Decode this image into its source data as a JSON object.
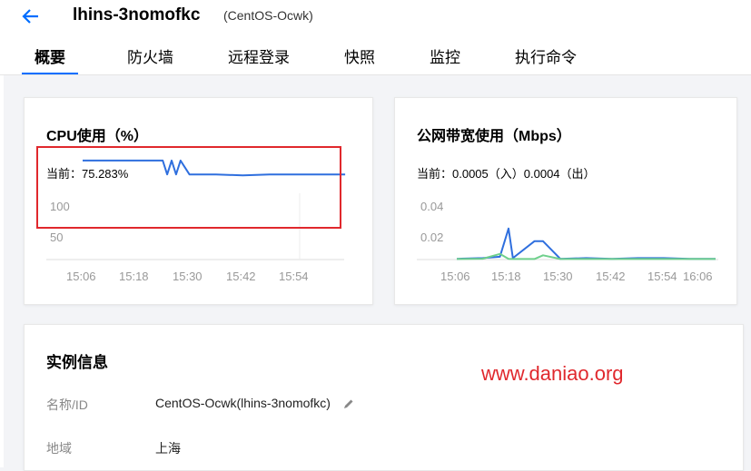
{
  "header": {
    "instance_name": "lhins-3nomofkc",
    "instance_os": "(CentOS-Ocwk)"
  },
  "tabs": [
    {
      "label": "概要",
      "active": true
    },
    {
      "label": "防火墙"
    },
    {
      "label": "远程登录"
    },
    {
      "label": "快照"
    },
    {
      "label": "监控"
    },
    {
      "label": "执行命令"
    }
  ],
  "cpu_card": {
    "title": "CPU使用（%）",
    "current": "当前：75.283%",
    "y_ticks": [
      "100",
      "50"
    ],
    "x_ticks": [
      "15:06",
      "15:18",
      "15:30",
      "15:42",
      "15:54"
    ]
  },
  "bw_card": {
    "title": "公网带宽使用（Mbps）",
    "current": "当前：0.0005（入）0.0004（出）",
    "y_ticks": [
      "0.04",
      "0.02"
    ],
    "x_ticks": [
      "15:06",
      "15:18",
      "15:30",
      "15:42",
      "15:54",
      "16:06"
    ]
  },
  "info": {
    "title": "实例信息",
    "rows": [
      {
        "label": "名称/ID",
        "value": "CentOS-Ocwk(lhins-3nomofkc)"
      },
      {
        "label": "地域",
        "value": "上海"
      }
    ]
  },
  "watermark": "www.daniao.org",
  "colors": {
    "accent": "#006eff",
    "line_blue": "#2f6fde",
    "line_green": "#6fd08c",
    "highlight": "#e0282d"
  },
  "chart_data": [
    {
      "type": "line",
      "title": "CPU使用（%）",
      "x": [
        "15:06",
        "15:12",
        "15:18",
        "15:21",
        "15:24",
        "15:25",
        "15:26",
        "15:27",
        "15:28",
        "15:30",
        "15:36",
        "15:42",
        "15:48",
        "15:54",
        "16:00",
        "16:05"
      ],
      "series": [
        {
          "values": [
            100,
            100,
            100,
            100,
            100,
            86,
            100,
            86,
            100,
            86,
            86,
            85,
            86,
            86,
            86,
            86
          ]
        }
      ],
      "ylim": [
        0,
        110
      ],
      "yticks": [
        100,
        50
      ],
      "xlabel": "",
      "ylabel": "",
      "grid": false
    },
    {
      "type": "line",
      "title": "公网带宽使用（Mbps）",
      "x": [
        "15:06",
        "15:12",
        "15:16",
        "15:18",
        "15:19",
        "15:24",
        "15:26",
        "15:30",
        "15:36",
        "15:42",
        "15:48",
        "15:54",
        "16:00",
        "16:06"
      ],
      "series": [
        {
          "values": [
            0.0005,
            0.001,
            0.002,
            0.022,
            0.001,
            0.013,
            0.013,
            0.0005,
            0.001,
            0.0005,
            0.001,
            0.001,
            0.0005,
            0.0005
          ]
        },
        {
          "values": [
            0.0004,
            0.0006,
            0.004,
            0.0005,
            0.0004,
            0.0004,
            0.003,
            0.0004,
            0.0004,
            0.0004,
            0.0004,
            0.0004,
            0.0004,
            0.0004
          ]
        }
      ],
      "ylim": [
        0,
        0.045
      ],
      "yticks": [
        0.04,
        0.02
      ],
      "xlabel": "",
      "ylabel": "",
      "grid": false
    }
  ]
}
